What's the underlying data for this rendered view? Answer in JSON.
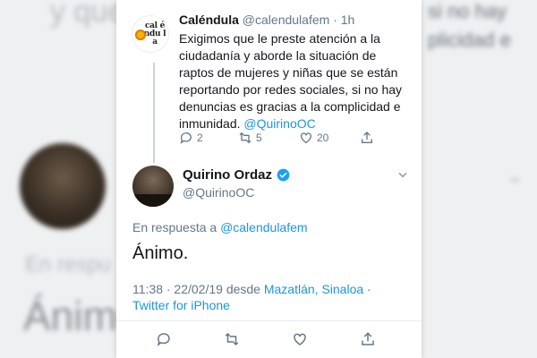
{
  "background": {
    "blur_text_1": "y que",
    "blur_text_2": "En respu",
    "blur_text_3": "Ánimo.",
    "blur_right_1": "si no hay",
    "blur_right_2": "plicidad e"
  },
  "tweet_original": {
    "avatar_logo_text": "cal éndu la",
    "display_name": "Caléndula",
    "handle": "@calendulafem",
    "time": "· 1h",
    "text": "Exigimos que le preste atención a la ciudadanía y aborde la situación de raptos de mujeres y niñas que se están reportando por redes sociales, si no hay denuncias es gracias a la complicidad e inmunidad.",
    "mention": "@QuirinoOC",
    "actions": {
      "reply_count": "2",
      "retweet_count": "5",
      "like_count": "20"
    }
  },
  "tweet_reply": {
    "display_name": "Quirino Ordaz",
    "handle": "@QuirinoOC",
    "reply_to_prefix": "En respuesta a",
    "reply_to_handle": "@calendulafem",
    "text": "Ánimo.",
    "timestamp": "11:38 · 22/02/19 desde",
    "location": "Mazatlán, Sinaloa",
    "source_sep": "·",
    "source": "Twitter for iPhone"
  },
  "colors": {
    "link": "#1b95e0",
    "muted": "#657786",
    "text": "#14171a",
    "verified": "#1da1f2"
  }
}
